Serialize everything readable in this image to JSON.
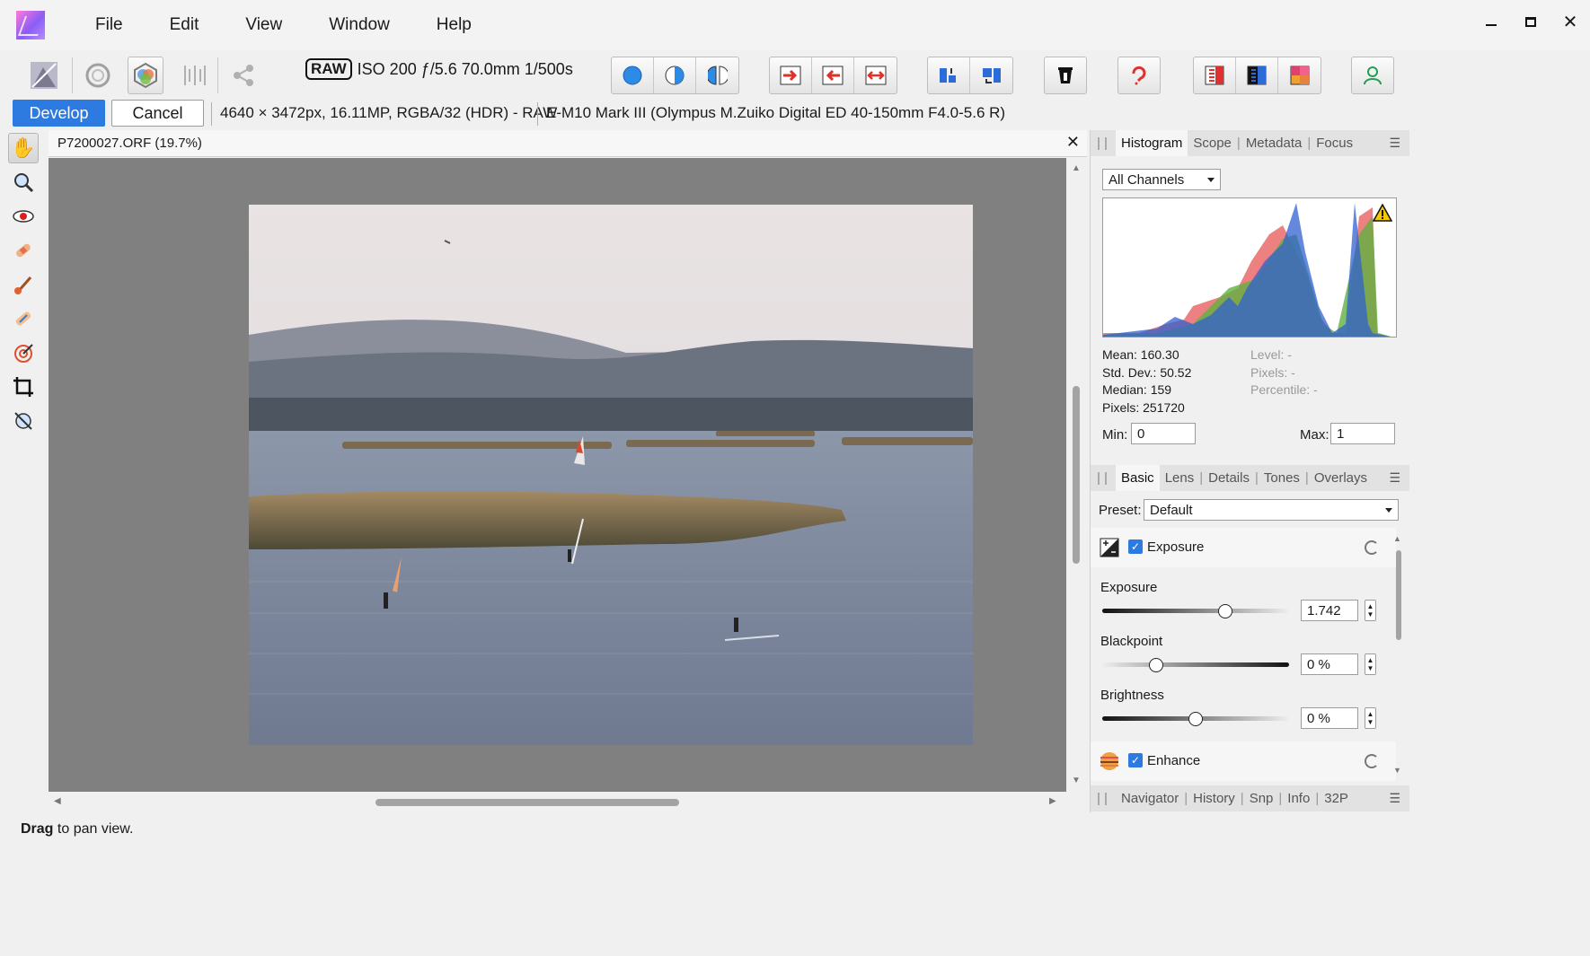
{
  "menu": [
    "File",
    "Edit",
    "View",
    "Window",
    "Help"
  ],
  "camera_info": {
    "badge": "RAW",
    "text": "ISO 200 ƒ/5.6 70.0mm 1/500s"
  },
  "context": {
    "develop_label": "Develop",
    "cancel_label": "Cancel",
    "image_info": "4640 × 3472px, 16.11MP, RGBA/32 (HDR) - RAW",
    "lens_info": "E-M10 Mark III (Olympus M.Zuiko Digital ED 40-150mm F4.0-5.6 R)"
  },
  "document": {
    "title": "P7200027.ORF (19.7%)"
  },
  "status": {
    "bold": "Drag",
    "rest": " to pan view."
  },
  "histogram_panel": {
    "tabs": [
      "Histogram",
      "Scope",
      "Metadata",
      "Focus"
    ],
    "channel": "All Channels",
    "stats_left": [
      "Mean: 160.30",
      "Std. Dev.: 50.52",
      "Median: 159",
      "Pixels: 251720"
    ],
    "stats_right": [
      "Level: -",
      "Pixels: -",
      "Percentile: -"
    ],
    "min_label": "Min:",
    "min_value": "0",
    "max_label": "Max:",
    "max_value": "1"
  },
  "develop_panel": {
    "tabs": [
      "Basic",
      "Lens",
      "Details",
      "Tones",
      "Overlays"
    ],
    "preset_label": "Preset:",
    "preset_value": "Default",
    "exposure_section": "Exposure",
    "sliders": [
      {
        "label": "Exposure",
        "value": "1.742",
        "position": 0.66
      },
      {
        "label": "Blackpoint",
        "value": "0 %",
        "position": 0.29
      },
      {
        "label": "Brightness",
        "value": "0 %",
        "position": 0.5
      }
    ],
    "enhance_section": "Enhance"
  },
  "bottom_panel": {
    "tabs": [
      "Navigator",
      "History",
      "Snp",
      "Info",
      "32P"
    ]
  },
  "colors": {
    "accent": "#2d7be0",
    "canvas": "#808080"
  }
}
